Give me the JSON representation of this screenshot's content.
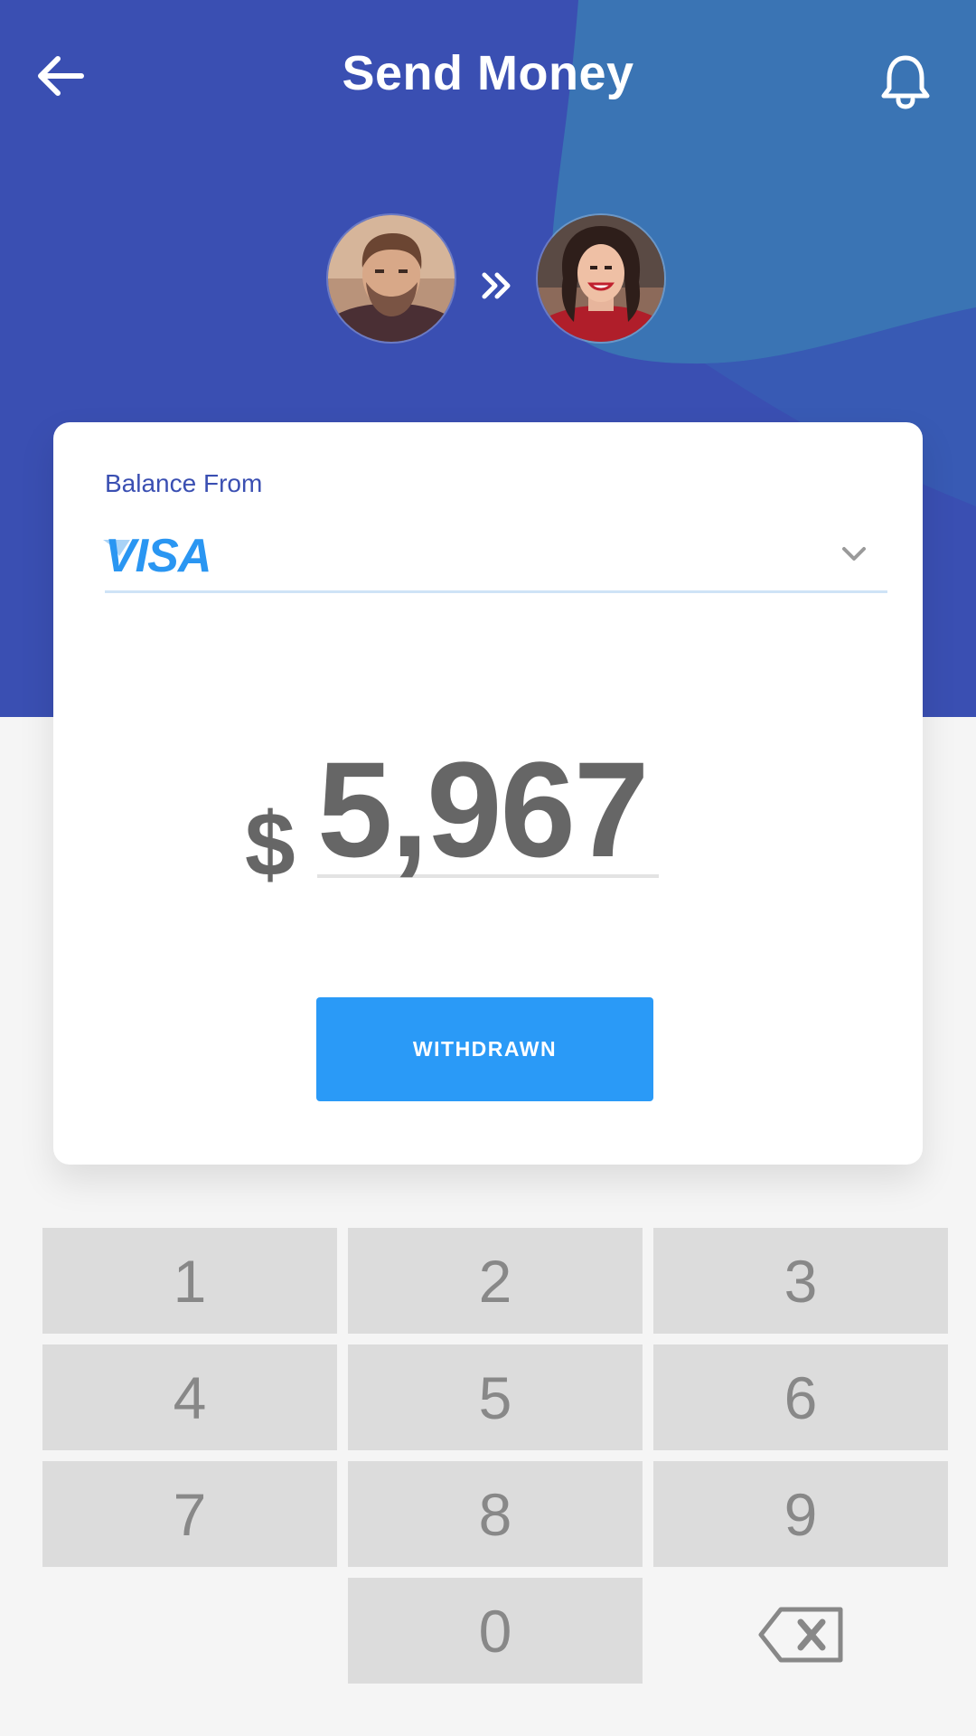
{
  "header": {
    "title": "Send Money",
    "back_icon": "arrow-left-icon",
    "notification_icon": "bell-icon"
  },
  "transfer": {
    "sender_avatar": "avatar-man",
    "receiver_avatar": "avatar-woman",
    "direction_icon": "double-chevron-right-icon"
  },
  "card": {
    "balance_label": "Balance From",
    "selected_card": "VISA",
    "dropdown_icon": "chevron-down-icon"
  },
  "amount": {
    "currency_symbol": "$",
    "value": "5,967"
  },
  "actions": {
    "withdraw_label": "WITHDRAWN"
  },
  "keypad": {
    "keys": [
      "1",
      "2",
      "3",
      "4",
      "5",
      "6",
      "7",
      "8",
      "9",
      "0"
    ],
    "delete_icon": "backspace-icon"
  },
  "colors": {
    "header_bg": "#3a4fb2",
    "header_wave": "#3a74b4",
    "primary_button": "#2a9af7",
    "visa_blue": "#2a96f2",
    "key_bg": "#dcdcdc",
    "text_gray": "#666666"
  }
}
